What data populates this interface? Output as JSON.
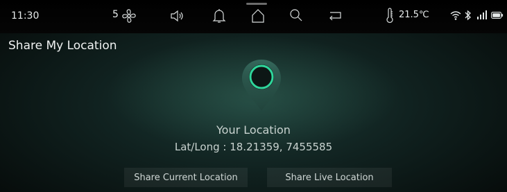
{
  "status_bar": {
    "time": "11:30",
    "fan_speed": "5",
    "temperature": "21.5℃",
    "icons": [
      "fan-icon",
      "volume-icon",
      "bell-icon",
      "home-icon",
      "search-icon",
      "back-icon",
      "thermometer-icon",
      "wifi-icon",
      "bluetooth-icon",
      "signal-icon",
      "battery-icon"
    ]
  },
  "page": {
    "title": "Share My Location"
  },
  "location": {
    "label": "Your Location",
    "coordinates": "Lat/Long : 18.21359, 7455585"
  },
  "buttons": {
    "share_current": "Share Current Location",
    "share_live": "Share Live Location"
  },
  "colors": {
    "accent": "#2fd69b",
    "background": "#10211f"
  }
}
